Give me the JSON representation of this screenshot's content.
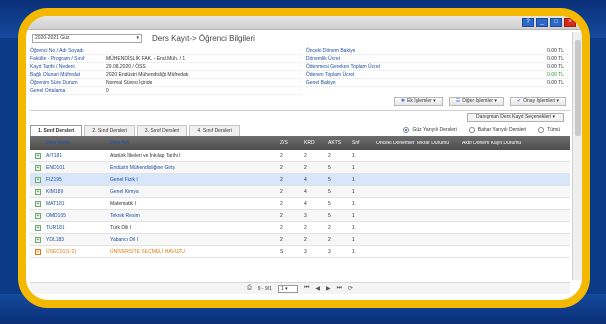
{
  "term": {
    "selected": "2020-2021 Güz"
  },
  "page_title": "Ders Kayıt-> Öğrenci Bilgileri",
  "student_info": [
    {
      "label": "Öğrenci No / Adı Soyadı",
      "value": ""
    },
    {
      "label": "Fakülte - Program / Sınıf",
      "value": "MÜHENDİSLİK FAK. - End.Müh. / 1"
    },
    {
      "label": "Kayıt Tarihi / Nedeni",
      "value": "29.08.2020 / ÖSS"
    },
    {
      "label": "Bağlı Olunan Müfredat",
      "value": "2020 Endüstri Mühendisliği Müfredatı"
    },
    {
      "label": "Öğrenim Süre Durum",
      "value": "Normal Süresi İçinde"
    },
    {
      "label": "Genel Ortalama",
      "value": "0"
    }
  ],
  "fee_info": [
    {
      "label": "Önceki Dönem Bakiye",
      "value": "0.00 TL"
    },
    {
      "label": "Dönemlik Ücret",
      "value": "0.00 TL"
    },
    {
      "label": "Ödenmesi Gereken Toplam Ücret",
      "value": "0.00 TL"
    },
    {
      "label": "Ödenen Toplam Ücret",
      "value": "0.00 TL"
    },
    {
      "label": "Genel Bakiye",
      "value": "0.00 TL"
    }
  ],
  "actions": {
    "ek": "Ek İşlemler",
    "diger": "Diğer İşlemler",
    "onay": "Onay İşlemleri"
  },
  "consultant_button": "Danışman Ders Kayıt Seçenekleri",
  "tabs": [
    "1. Sınıf Dersleri",
    "2. Sınıf Dersleri",
    "3. Sınıf Dersleri",
    "4. Sınıf Dersleri"
  ],
  "radios": [
    "Güz Yarıyılı Dersleri",
    "Bahar Yarıyılı Dersleri",
    "Tümü"
  ],
  "columns": {
    "code": "Ders Kodu",
    "name": "Ders Adı",
    "zs": "Z/S",
    "krd": "KRD",
    "akts": "AKTS",
    "sinif": "Snf",
    "prev": "Önceki Dönemler Tekrar Durumu",
    "active": "Aktif Dönem Kayıt Durumu"
  },
  "rows": [
    {
      "code": "AIT181",
      "name": "Atatürk İlkeleri ve İnkılap Tarihi I",
      "zs": "2",
      "krd": "2",
      "akts": "2",
      "sinif": "1"
    },
    {
      "code": "END101",
      "name": "Endüstri Mühendisliğine Giriş",
      "zs": "2",
      "krd": "2",
      "akts": "5",
      "sinif": "1"
    },
    {
      "code": "FIZ195",
      "name": "Genel Fizik I",
      "zs": "2",
      "krd": "4",
      "akts": "5",
      "sinif": "1"
    },
    {
      "code": "KIM189",
      "name": "Genel Kimya",
      "zs": "2",
      "krd": "4",
      "akts": "5",
      "sinif": "1"
    },
    {
      "code": "MAT181",
      "name": "Matematik I",
      "zs": "2",
      "krd": "4",
      "akts": "5",
      "sinif": "1"
    },
    {
      "code": "OMD105",
      "name": "Teknik Resim",
      "zs": "2",
      "krd": "3",
      "akts": "5",
      "sinif": "1"
    },
    {
      "code": "TUR181",
      "name": "Türk Dili I",
      "zs": "2",
      "krd": "2",
      "akts": "2",
      "sinif": "1"
    },
    {
      "code": "YDL183",
      "name": "Yabancı Dil I",
      "zs": "2",
      "krd": "2",
      "akts": "2",
      "sinif": "1"
    },
    {
      "code": "ÜSEC01(1-2)",
      "name": "ÜNİVERSİTE SEÇMELİ HAVUZU",
      "zs": "S",
      "krd": "3",
      "akts": "3",
      "sinif": "1"
    }
  ],
  "pager": {
    "info": "9 - 9/1",
    "page": "1"
  }
}
